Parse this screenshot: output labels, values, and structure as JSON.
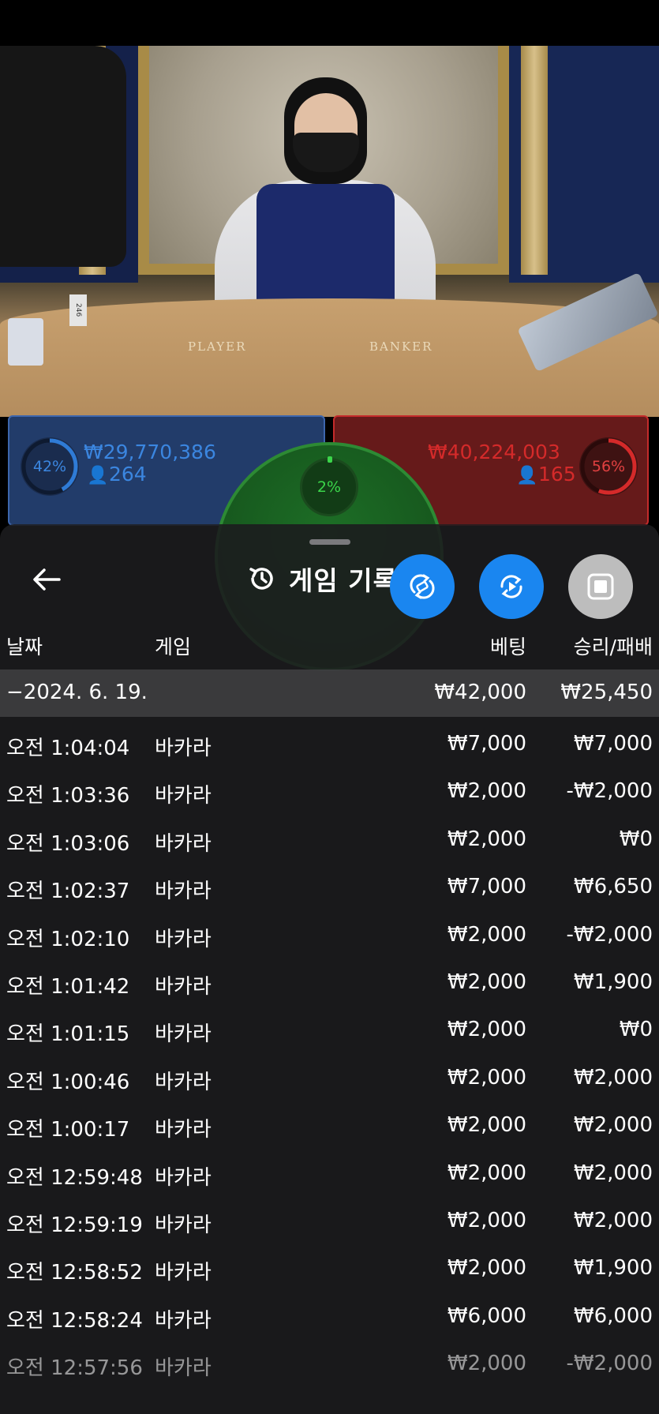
{
  "scene": {
    "felt_player_label": "PLAYER",
    "felt_banker_label": "BANKER",
    "shoe_label": "246"
  },
  "bets": {
    "player": {
      "percent": "42%",
      "amount": "₩29,770,386",
      "count": "264",
      "color": "#2f7bd6"
    },
    "banker": {
      "percent": "56%",
      "amount": "₩40,224,003",
      "count": "165",
      "color": "#d42a2a"
    },
    "tie": {
      "percent": "2%",
      "color": "#3bd54a"
    }
  },
  "sheet": {
    "title": "게임 기록",
    "back_icon": "arrow-left-icon",
    "title_icon": "history-icon",
    "actions": [
      {
        "name": "sync-icon",
        "color": "#1a86f0"
      },
      {
        "name": "replay-icon",
        "color": "#1a86f0"
      },
      {
        "name": "stop-icon",
        "color": "#bdbdbd"
      }
    ],
    "columns": {
      "date": "날짜",
      "game": "게임",
      "bet": "베팅",
      "result": "승리/패배"
    },
    "date_group": {
      "date": "−2024. 6. 19.",
      "bet_total": "₩42,000",
      "result_total": "₩25,450"
    },
    "rows": [
      {
        "time": "오전 1:04:04",
        "game": "바카라",
        "bet": "₩7,000",
        "result": "₩7,000"
      },
      {
        "time": "오전 1:03:36",
        "game": "바카라",
        "bet": "₩2,000",
        "result": "-₩2,000"
      },
      {
        "time": "오전 1:03:06",
        "game": "바카라",
        "bet": "₩2,000",
        "result": "₩0"
      },
      {
        "time": "오전 1:02:37",
        "game": "바카라",
        "bet": "₩7,000",
        "result": "₩6,650"
      },
      {
        "time": "오전 1:02:10",
        "game": "바카라",
        "bet": "₩2,000",
        "result": "-₩2,000"
      },
      {
        "time": "오전 1:01:42",
        "game": "바카라",
        "bet": "₩2,000",
        "result": "₩1,900"
      },
      {
        "time": "오전 1:01:15",
        "game": "바카라",
        "bet": "₩2,000",
        "result": "₩0"
      },
      {
        "time": "오전 1:00:46",
        "game": "바카라",
        "bet": "₩2,000",
        "result": "₩2,000"
      },
      {
        "time": "오전 1:00:17",
        "game": "바카라",
        "bet": "₩2,000",
        "result": "₩2,000"
      },
      {
        "time": "오전 12:59:48",
        "game": "바카라",
        "bet": "₩2,000",
        "result": "₩2,000"
      },
      {
        "time": "오전 12:59:19",
        "game": "바카라",
        "bet": "₩2,000",
        "result": "₩2,000"
      },
      {
        "time": "오전 12:58:52",
        "game": "바카라",
        "bet": "₩2,000",
        "result": "₩1,900"
      },
      {
        "time": "오전 12:58:24",
        "game": "바카라",
        "bet": "₩6,000",
        "result": "₩6,000"
      },
      {
        "time": "오전 12:57:56",
        "game": "바카라",
        "bet": "₩2,000",
        "result": "-₩2,000"
      }
    ]
  }
}
